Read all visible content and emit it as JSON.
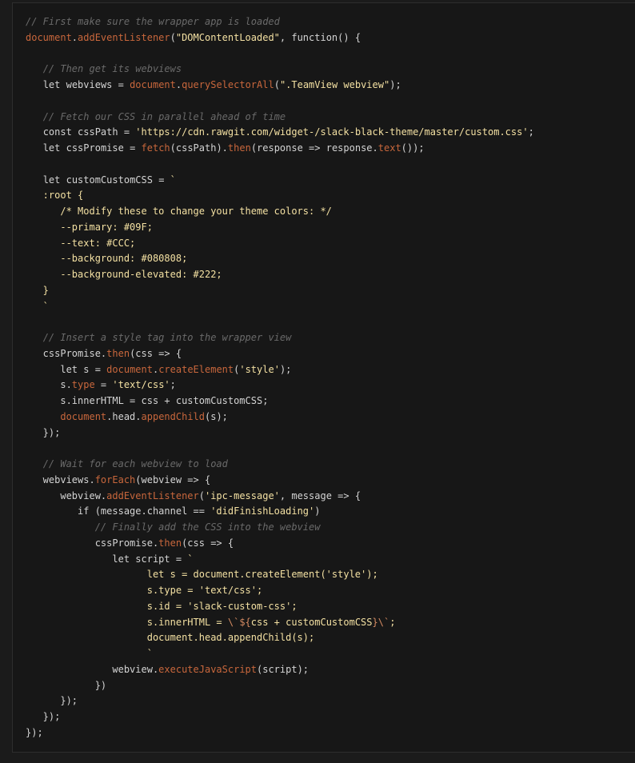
{
  "code_lines": [
    [
      [
        "c",
        "// First make sure the wrapper app is loaded"
      ]
    ],
    [
      [
        "v",
        "document"
      ],
      [
        "p",
        "."
      ],
      [
        "v",
        "addEventListener"
      ],
      [
        "p",
        "("
      ],
      [
        "s",
        "\"DOMContentLoaded\""
      ],
      [
        "p",
        ", "
      ],
      [
        "k",
        "function"
      ],
      [
        "p",
        "() {"
      ]
    ],
    [],
    [
      [
        "n",
        "   "
      ],
      [
        "c",
        "// Then get its webviews"
      ]
    ],
    [
      [
        "n",
        "   "
      ],
      [
        "k",
        "let"
      ],
      [
        "n",
        " webviews = "
      ],
      [
        "v",
        "document"
      ],
      [
        "p",
        "."
      ],
      [
        "v",
        "querySelectorAll"
      ],
      [
        "p",
        "("
      ],
      [
        "s",
        "\".TeamView webview\""
      ],
      [
        "p",
        ");"
      ]
    ],
    [],
    [
      [
        "n",
        "   "
      ],
      [
        "c",
        "// Fetch our CSS in parallel ahead of time"
      ]
    ],
    [
      [
        "n",
        "   "
      ],
      [
        "k",
        "const"
      ],
      [
        "n",
        " cssPath = "
      ],
      [
        "s",
        "'https://cdn.rawgit.com/widget-/slack-black-theme/master/custom.css'"
      ],
      [
        "p",
        ";"
      ]
    ],
    [
      [
        "n",
        "   "
      ],
      [
        "k",
        "let"
      ],
      [
        "n",
        " cssPromise = "
      ],
      [
        "v",
        "fetch"
      ],
      [
        "p",
        "(cssPath)."
      ],
      [
        "v",
        "then"
      ],
      [
        "p",
        "(response => response."
      ],
      [
        "v",
        "text"
      ],
      [
        "p",
        "());"
      ]
    ],
    [],
    [
      [
        "n",
        "   "
      ],
      [
        "k",
        "let"
      ],
      [
        "n",
        " customCustomCSS = "
      ],
      [
        "s",
        "`"
      ]
    ],
    [
      [
        "s",
        "   :root {"
      ]
    ],
    [
      [
        "s",
        "      /* Modify these to change your theme colors: */"
      ]
    ],
    [
      [
        "s",
        "      --primary: #09F;"
      ]
    ],
    [
      [
        "s",
        "      --text: #CCC;"
      ]
    ],
    [
      [
        "s",
        "      --background: #080808;"
      ]
    ],
    [
      [
        "s",
        "      --background-elevated: #222;"
      ]
    ],
    [
      [
        "s",
        "   }"
      ]
    ],
    [
      [
        "s",
        "   `"
      ]
    ],
    [],
    [
      [
        "n",
        "   "
      ],
      [
        "c",
        "// Insert a style tag into the wrapper view"
      ]
    ],
    [
      [
        "n",
        "   cssPromise."
      ],
      [
        "v",
        "then"
      ],
      [
        "p",
        "(css => {"
      ]
    ],
    [
      [
        "n",
        "      "
      ],
      [
        "k",
        "let"
      ],
      [
        "n",
        " s = "
      ],
      [
        "v",
        "document"
      ],
      [
        "p",
        "."
      ],
      [
        "v",
        "createElement"
      ],
      [
        "p",
        "("
      ],
      [
        "s",
        "'style'"
      ],
      [
        "p",
        ");"
      ]
    ],
    [
      [
        "n",
        "      s."
      ],
      [
        "v",
        "type"
      ],
      [
        "n",
        " = "
      ],
      [
        "s",
        "'text/css'"
      ],
      [
        "p",
        ";"
      ]
    ],
    [
      [
        "n",
        "      s.innerHTML = css + customCustomCSS;"
      ]
    ],
    [
      [
        "n",
        "      "
      ],
      [
        "v",
        "document"
      ],
      [
        "p",
        ".head."
      ],
      [
        "v",
        "appendChild"
      ],
      [
        "p",
        "(s);"
      ]
    ],
    [
      [
        "n",
        "   });"
      ]
    ],
    [],
    [
      [
        "n",
        "   "
      ],
      [
        "c",
        "// Wait for each webview to load"
      ]
    ],
    [
      [
        "n",
        "   webviews."
      ],
      [
        "v",
        "forEach"
      ],
      [
        "p",
        "(webview => {"
      ]
    ],
    [
      [
        "n",
        "      webview."
      ],
      [
        "v",
        "addEventListener"
      ],
      [
        "p",
        "("
      ],
      [
        "s",
        "'ipc-message'"
      ],
      [
        "p",
        ", message => {"
      ]
    ],
    [
      [
        "n",
        "         "
      ],
      [
        "k",
        "if"
      ],
      [
        "n",
        " (message.channel == "
      ],
      [
        "s",
        "'didFinishLoading'"
      ],
      [
        "p",
        ")"
      ]
    ],
    [
      [
        "n",
        "            "
      ],
      [
        "c",
        "// Finally add the CSS into the webview"
      ]
    ],
    [
      [
        "n",
        "            cssPromise."
      ],
      [
        "v",
        "then"
      ],
      [
        "p",
        "(css => {"
      ]
    ],
    [
      [
        "n",
        "               "
      ],
      [
        "k",
        "let"
      ],
      [
        "n",
        " script = "
      ],
      [
        "s",
        "`"
      ]
    ],
    [
      [
        "s",
        "                     let s = document.createElement('style');"
      ]
    ],
    [
      [
        "s",
        "                     s.type = 'text/css';"
      ]
    ],
    [
      [
        "s",
        "                     s.id = 'slack-custom-css';"
      ]
    ],
    [
      [
        "s",
        "                     s.innerHTML = "
      ],
      [
        "r",
        "\\`${"
      ],
      [
        "s",
        "css + customCustomCSS"
      ],
      [
        "r",
        "}\\`"
      ],
      [
        "s",
        ";"
      ]
    ],
    [
      [
        "s",
        "                     document.head.appendChild(s);"
      ]
    ],
    [
      [
        "s",
        "                     `"
      ]
    ],
    [
      [
        "n",
        "               webview."
      ],
      [
        "v",
        "executeJavaScript"
      ],
      [
        "p",
        "(script);"
      ]
    ],
    [
      [
        "n",
        "            })"
      ]
    ],
    [
      [
        "n",
        "      });"
      ]
    ],
    [
      [
        "n",
        "   });"
      ]
    ],
    [
      [
        "n",
        "});"
      ]
    ]
  ],
  "colors": {
    "background": "#171717",
    "comment": "#6a6a6a",
    "plain": "#d4d4d4",
    "method": "#c9673c",
    "string": "#f3e0a2"
  }
}
